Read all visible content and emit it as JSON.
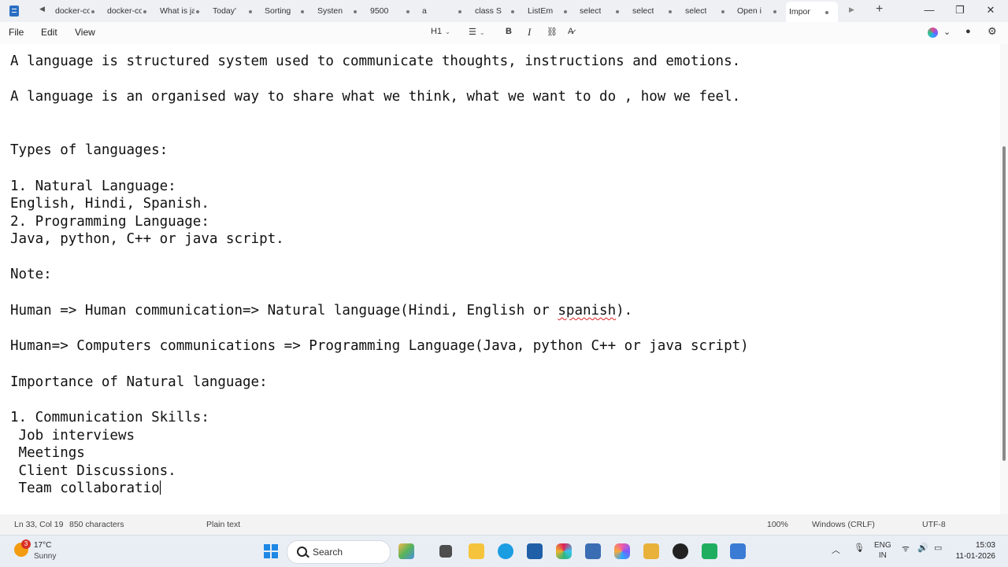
{
  "tabs": [
    {
      "label": "docker-com"
    },
    {
      "label": "docker-com"
    },
    {
      "label": "What is java"
    },
    {
      "label": "Today'"
    },
    {
      "label": "Sorting"
    },
    {
      "label": "Systen"
    },
    {
      "label": "9500"
    },
    {
      "label": "a"
    },
    {
      "label": "class S"
    },
    {
      "label": "ListEm"
    },
    {
      "label": "select"
    },
    {
      "label": "select"
    },
    {
      "label": "select"
    },
    {
      "label": "Open i"
    },
    {
      "label": "Impor",
      "active": true
    }
  ],
  "menu": {
    "file": "File",
    "edit": "Edit",
    "view": "View"
  },
  "toolbar": {
    "heading": "H1",
    "bold": "B",
    "italic": "I"
  },
  "editor_lines": [
    "A language is structured system used to communicate thoughts, instructions and emotions.",
    "",
    "A language is an organised way to share what we think, what we want to do , how we feel.",
    "",
    "",
    "Types of languages:",
    "",
    "1. Natural Language:",
    "English, Hindi, Spanish.",
    "2. Programming Language:",
    "Java, python, C++ or java script.",
    "",
    "Note:",
    "",
    "Human => Human communication=> Natural language(Hindi, English or spanish).",
    "",
    "Human=> Computers communications => Programming Language(Java, python C++ or java script)",
    "",
    "Importance of Natural language:",
    "",
    "1. Communication Skills:",
    " Job interviews",
    " Meetings",
    " Client Discussions.",
    " Team collaboratio"
  ],
  "status": {
    "position": "Ln 33, Col 19",
    "characters": "850 characters",
    "format": "Plain text",
    "zoom": "100%",
    "line_ending": "Windows (CRLF)",
    "encoding": "UTF-8"
  },
  "taskbar": {
    "weather_badge": "3",
    "temperature": "17°C",
    "condition": "Sunny",
    "search_label": "Search",
    "lang_top": "ENG",
    "lang_bottom": "IN",
    "time": "15:03",
    "date": "11-01-2026"
  },
  "colors": {
    "accent": "#1e88e5",
    "spell_error": "#d22222"
  }
}
